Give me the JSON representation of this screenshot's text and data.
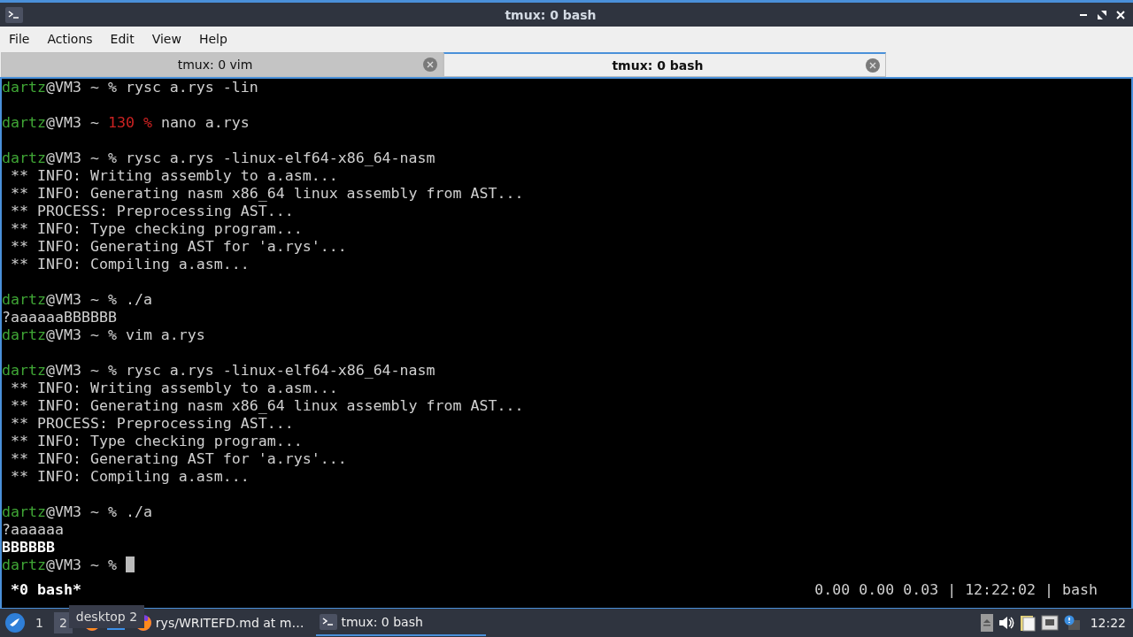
{
  "window": {
    "title": "tmux: 0 bash"
  },
  "menu": [
    "File",
    "Actions",
    "Edit",
    "View",
    "Help"
  ],
  "tabs": [
    {
      "label": "tmux: 0 vim",
      "selected": false
    },
    {
      "label": "tmux: 0 bash",
      "selected": true
    }
  ],
  "terminal": {
    "lines": [
      {
        "kind": "prompt",
        "user": "dartz",
        "host": "@VM3 ~",
        "symbol": "%",
        "command": "rysc a.rys -lin"
      },
      {
        "kind": "blank"
      },
      {
        "kind": "prompt",
        "user": "dartz",
        "host": "@VM3 ~",
        "exit_code": "130",
        "symbol": "%",
        "command": "nano a.rys"
      },
      {
        "kind": "blank"
      },
      {
        "kind": "prompt",
        "user": "dartz",
        "host": "@VM3 ~",
        "symbol": "%",
        "command": "rysc a.rys -linux-elf64-x86_64-nasm"
      },
      {
        "kind": "output",
        "text": " ** INFO: Writing assembly to a.asm...",
        "bold": false
      },
      {
        "kind": "output",
        "text": " ** INFO: Generating nasm x86_64 linux assembly from AST...",
        "bold": false
      },
      {
        "kind": "output",
        "text": " ** PROCESS: Preprocessing AST...",
        "bold": false
      },
      {
        "kind": "output",
        "text": " ** INFO: Type checking program...",
        "bold": false
      },
      {
        "kind": "output",
        "text": " ** INFO: Generating AST for 'a.rys'...",
        "bold": false
      },
      {
        "kind": "output",
        "text": " ** INFO: Compiling a.asm...",
        "bold": false
      },
      {
        "kind": "blank"
      },
      {
        "kind": "prompt",
        "user": "dartz",
        "host": "@VM3 ~",
        "symbol": "%",
        "command": "./a"
      },
      {
        "kind": "output",
        "text": "?aaaaaaBBBBBB",
        "bold": false
      },
      {
        "kind": "prompt",
        "user": "dartz",
        "host": "@VM3 ~",
        "symbol": "%",
        "command": "vim a.rys"
      },
      {
        "kind": "blank"
      },
      {
        "kind": "prompt",
        "user": "dartz",
        "host": "@VM3 ~",
        "symbol": "%",
        "command": "rysc a.rys -linux-elf64-x86_64-nasm"
      },
      {
        "kind": "output",
        "text": " ** INFO: Writing assembly to a.asm...",
        "bold": false
      },
      {
        "kind": "output",
        "text": " ** INFO: Generating nasm x86_64 linux assembly from AST...",
        "bold": false
      },
      {
        "kind": "output",
        "text": " ** PROCESS: Preprocessing AST...",
        "bold": false
      },
      {
        "kind": "output",
        "text": " ** INFO: Type checking program...",
        "bold": false
      },
      {
        "kind": "output",
        "text": " ** INFO: Generating AST for 'a.rys'...",
        "bold": false
      },
      {
        "kind": "output",
        "text": " ** INFO: Compiling a.asm...",
        "bold": false
      },
      {
        "kind": "blank"
      },
      {
        "kind": "prompt",
        "user": "dartz",
        "host": "@VM3 ~",
        "symbol": "%",
        "command": "./a"
      },
      {
        "kind": "output",
        "text": "?aaaaaa",
        "bold": false
      },
      {
        "kind": "output",
        "text": "BBBBBB",
        "bold": true
      },
      {
        "kind": "prompt",
        "user": "dartz",
        "host": "@VM3 ~",
        "symbol": "%",
        "cursor": true
      }
    ],
    "status_bar": {
      "window": "*0 bash*",
      "right": "0.00 0.00 0.03 | 12:22:02 | bash"
    }
  },
  "taskbar": {
    "desktops": [
      {
        "label": "1",
        "selected": false
      },
      {
        "label": "2",
        "selected": true
      }
    ],
    "tooltip": "desktop 2",
    "tasks": [
      {
        "label": "rys/WRITEFD.md at m…",
        "kind": "browser",
        "active": false
      },
      {
        "label": "tmux: 0 bash",
        "kind": "terminal",
        "active": true
      }
    ],
    "clock": "12:22"
  }
}
